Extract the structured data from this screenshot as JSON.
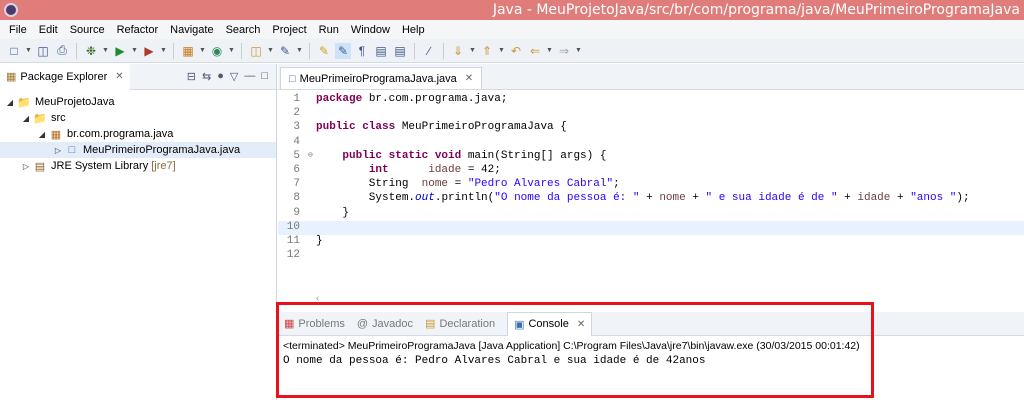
{
  "window": {
    "title": "Java - MeuProjetoJava/src/br/com/programa/java/MeuPrimeiroProgramaJava"
  },
  "menu": [
    "File",
    "Edit",
    "Source",
    "Refactor",
    "Navigate",
    "Search",
    "Project",
    "Run",
    "Window",
    "Help"
  ],
  "toolbar": {
    "icons": [
      "new-icon",
      "save-icon",
      "print-icon",
      "debug-icon",
      "run-icon",
      "external-tools-icon",
      "new-java-project-icon",
      "new-class-icon",
      "open-type-icon",
      "search-icon",
      "toggle-mark-occurrences-icon",
      "toggle-breadcrumb-icon",
      "show-whitespace-icon",
      "block-selection-icon",
      "next-annotation-icon",
      "previous-annotation-icon",
      "back-icon",
      "forward-icon"
    ]
  },
  "explorer": {
    "tab_label": "Package Explorer",
    "tree": [
      {
        "label": "MeuProjetoJava",
        "icon": "project-icon",
        "level": 0,
        "expanded": true
      },
      {
        "label": "src",
        "icon": "source-folder-icon",
        "level": 1,
        "expanded": true
      },
      {
        "label": "br.com.programa.java",
        "icon": "package-icon",
        "level": 2,
        "expanded": true
      },
      {
        "label": "MeuPrimeiroProgramaJava.java",
        "icon": "java-file-icon",
        "level": 3,
        "expanded": false
      },
      {
        "label": "JRE System Library",
        "suffix": "[jre7]",
        "icon": "library-icon",
        "level": 1,
        "expanded": false
      }
    ]
  },
  "editor": {
    "tab_label": "MeuPrimeiroProgramaJava.java",
    "lines": [
      {
        "n": "1",
        "text": "package br.com.programa.java;"
      },
      {
        "n": "2",
        "text": ""
      },
      {
        "n": "3",
        "text": "public class MeuPrimeiroProgramaJava {"
      },
      {
        "n": "4",
        "text": ""
      },
      {
        "n": "5",
        "text": "    public static void main(String[] args) {"
      },
      {
        "n": "6",
        "text": "        int      idade = 42;"
      },
      {
        "n": "7",
        "text": "        String  nome = \"Pedro Alvares Cabral\";"
      },
      {
        "n": "8",
        "text": "        System.out.println(\"O nome da pessoa é: \" + nome + \" e sua idade é de \" + idade + \"anos \");"
      },
      {
        "n": "9",
        "text": "    }"
      },
      {
        "n": "10",
        "text": ""
      },
      {
        "n": "11",
        "text": "}"
      },
      {
        "n": "12",
        "text": ""
      }
    ]
  },
  "console": {
    "tabs": [
      "Problems",
      "Javadoc",
      "Declaration",
      "Console"
    ],
    "active_tab": "Console",
    "status": "<terminated> MeuPrimeiroProgramaJava [Java Application] C:\\Program Files\\Java\\jre7\\bin\\javaw.exe (30/03/2015 00:01:42)",
    "output": "O nome da pessoa é: Pedro Alvares Cabral e sua idade é de 42anos"
  },
  "colors": {
    "highlight_box": "#e8121b",
    "titlebar": "#e07c7a"
  }
}
